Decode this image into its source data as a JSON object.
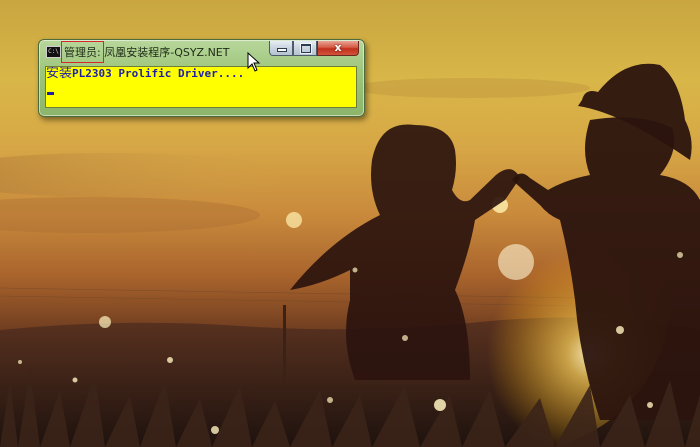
{
  "window": {
    "icon_text": "C:\\",
    "title_admin": "管理员:",
    "title_app": "凤凰安装程序-QSYZ.NET",
    "close_glyph": "x",
    "console_prefix": "安装",
    "console_text": "PL2303 Prolific Driver...."
  },
  "colors": {
    "console_background": "#ffff00",
    "console_text": "#1b1fa8",
    "title_bar": "#9cc47a",
    "close_button": "#c1301d"
  },
  "icons": {
    "window_icon": "cmd-icon",
    "minimize": "minimize-icon",
    "maximize": "maximize-icon",
    "close": "close-icon",
    "pointer": "mouse-pointer-icon"
  }
}
